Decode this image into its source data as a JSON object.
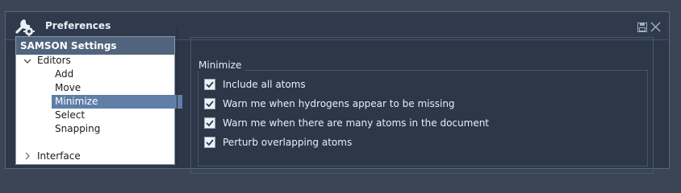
{
  "window": {
    "title": "Preferences",
    "icons": [
      "wrench-gear-icon",
      "save-icon",
      "close-icon"
    ]
  },
  "tree": {
    "header": "SAMSON Settings",
    "items": [
      {
        "label": "Editors",
        "level": 0,
        "expanded": true
      },
      {
        "label": "Add",
        "level": 1
      },
      {
        "label": "Move",
        "level": 1
      },
      {
        "label": "Minimize",
        "level": 1,
        "selected": true
      },
      {
        "label": "Select",
        "level": 1
      },
      {
        "label": "Snapping",
        "level": 1
      },
      {
        "label": "Interface",
        "level": 0,
        "expanded": false
      }
    ]
  },
  "minimize": {
    "group_title": "Minimize",
    "options": [
      {
        "label": "Include all atoms",
        "checked": true
      },
      {
        "label": "Warn me when hydrogens appear to be missing",
        "checked": true
      },
      {
        "label": "Warn me when there are many atoms in the document",
        "checked": true
      },
      {
        "label": "Perturb overlapping atoms",
        "checked": true
      }
    ]
  },
  "colors": {
    "window_bg": "#2c3848",
    "selection": "#5f7fa8",
    "tree_header": "#52647d"
  }
}
